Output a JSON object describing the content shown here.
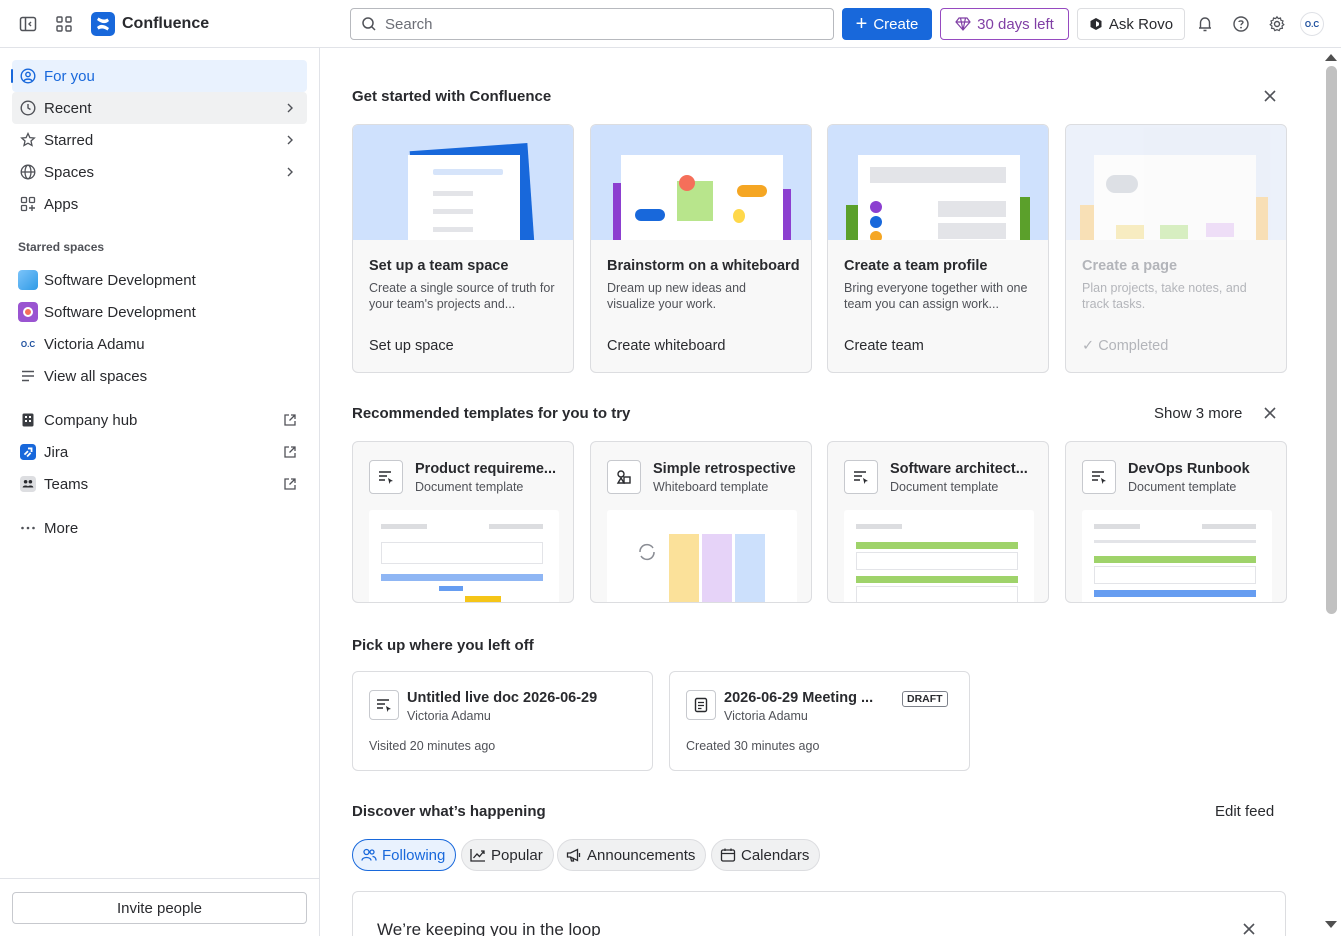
{
  "header": {
    "app_name": "Confluence",
    "search_placeholder": "Search",
    "create_label": "Create",
    "trial_label": "30 days left",
    "rovo_label": "Ask Rovo",
    "avatar_initials": "O.C"
  },
  "sidebar": {
    "nav": [
      {
        "label": "For you",
        "icon": "user-circle-icon"
      },
      {
        "label": "Recent",
        "icon": "clock-icon"
      },
      {
        "label": "Starred",
        "icon": "star-icon"
      },
      {
        "label": "Spaces",
        "icon": "globe-icon"
      },
      {
        "label": "Apps",
        "icon": "apps-icon"
      }
    ],
    "starred_title": "Starred spaces",
    "starred": [
      {
        "label": "Software Development"
      },
      {
        "label": "Software Development"
      },
      {
        "label": "Victoria Adamu"
      },
      {
        "label": "View all spaces"
      }
    ],
    "links": [
      {
        "label": "Company hub"
      },
      {
        "label": "Jira"
      },
      {
        "label": "Teams"
      }
    ],
    "more_label": "More",
    "invite_label": "Invite people"
  },
  "get_started": {
    "title": "Get started with Confluence",
    "cards": [
      {
        "title": "Set up a team space",
        "desc": "Create a single source of truth for your team's projects and...",
        "action": "Set up space"
      },
      {
        "title": "Brainstorm on a whiteboard",
        "desc": "Dream up new ideas and visualize your work.",
        "action": "Create whiteboard"
      },
      {
        "title": "Create a team profile",
        "desc": "Bring everyone together with one team you can assign work...",
        "action": "Create team"
      },
      {
        "title": "Create a page",
        "desc": "Plan projects, take notes, and track tasks.",
        "action": "Completed"
      }
    ]
  },
  "templates": {
    "title": "Recommended templates for you to try",
    "show_more": "Show 3 more",
    "items": [
      {
        "title": "Product requireme...",
        "type": "Document template"
      },
      {
        "title": "Simple retrospective",
        "type": "Whiteboard template"
      },
      {
        "title": "Software architect...",
        "type": "Document template"
      },
      {
        "title": "DevOps Runbook",
        "type": "Document template"
      }
    ]
  },
  "recent": {
    "title": "Pick up where you left off",
    "items": [
      {
        "title": "Untitled live doc 2026-06-29",
        "author": "Victoria Adamu",
        "time": "Visited 20 minutes ago"
      },
      {
        "title": "2026-06-29 Meeting ...",
        "author": "Victoria Adamu",
        "time": "Created 30 minutes ago",
        "badge": "DRAFT"
      }
    ]
  },
  "discover": {
    "title": "Discover what’s happening",
    "edit_feed": "Edit feed",
    "chips": [
      "Following",
      "Popular",
      "Announcements",
      "Calendars"
    ],
    "feed_title": "We’re keeping you in the loop"
  },
  "colors": {
    "primary": "#1868db",
    "trial": "#803fa5"
  }
}
